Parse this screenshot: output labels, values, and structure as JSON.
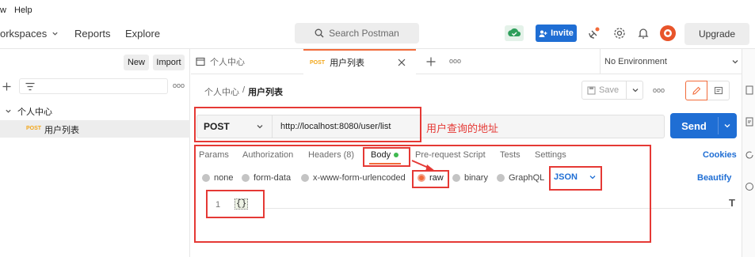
{
  "menubar": {
    "items": [
      "w",
      "Help"
    ]
  },
  "header": {
    "nav": [
      "orkspaces",
      "Reports",
      "Explore"
    ],
    "search_placeholder": "Search Postman",
    "invite_label": "Invite",
    "upgrade_label": "Upgrade"
  },
  "sidebar": {
    "new_label": "New",
    "import_label": "Import",
    "more_label": "ooo",
    "collection_name": "个人中心",
    "request_method": "POST",
    "request_name": "用户列表"
  },
  "tabs": {
    "tab1_label": "个人中心",
    "tab2_method": "POST",
    "tab2_label": "用户列表",
    "more_label": "ooo",
    "environment": "No Environment"
  },
  "request": {
    "breadcrumb_parent": "个人中心",
    "breadcrumb_sep": "/",
    "breadcrumb_current": "用户列表",
    "save_label": "Save",
    "more_label": "ooo",
    "method": "POST",
    "url": "http://localhost:8080/user/list",
    "send_label": "Send",
    "annotation": "用户查询的地址"
  },
  "subtabs": {
    "items": [
      "Params",
      "Authorization",
      "Headers (8)",
      "Body",
      "Pre-request Script",
      "Tests",
      "Settings"
    ],
    "cookies": "Cookies"
  },
  "body_types": {
    "options": [
      "none",
      "form-data",
      "x-www-form-urlencoded",
      "raw",
      "binary",
      "GraphQL"
    ],
    "format": "JSON",
    "beautify": "Beautify"
  },
  "editor": {
    "line_number": "1",
    "content": "{}"
  },
  "colors": {
    "accent": "#f26b3a",
    "primary": "#1f6ed4",
    "annotation_red": "#e53935",
    "body_dot": "#3fb950"
  }
}
